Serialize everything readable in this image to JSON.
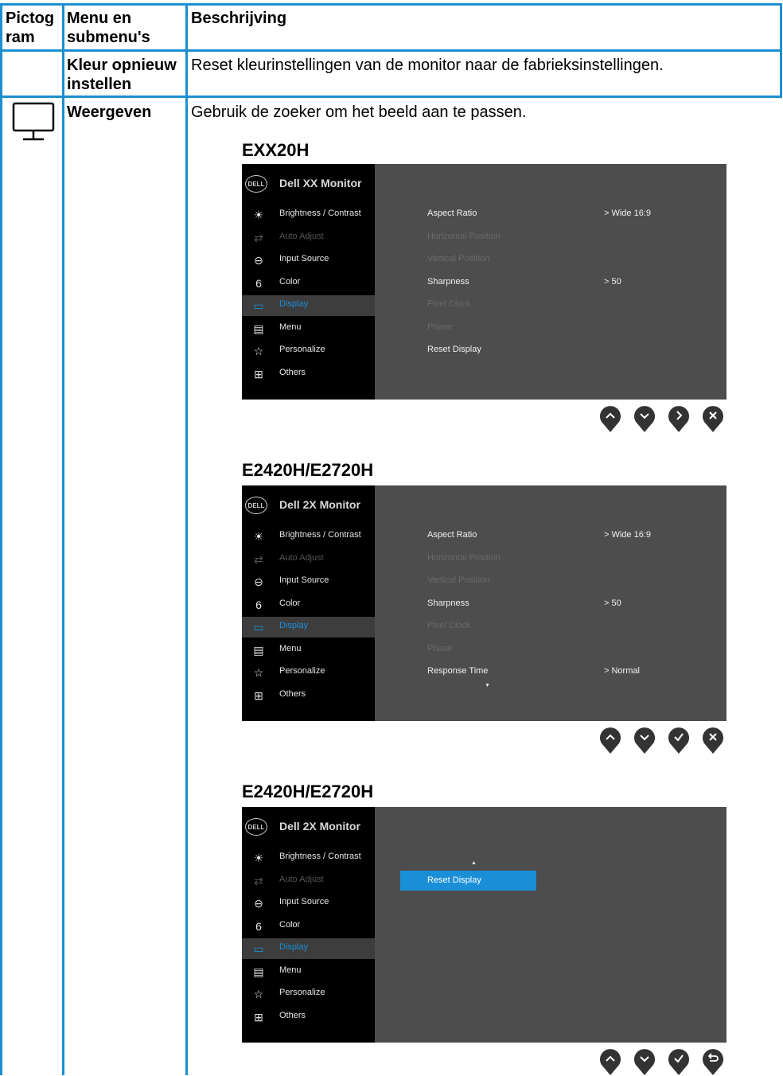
{
  "table": {
    "headers": {
      "icon": "Pictog ram",
      "menu": "Menu en submenu's",
      "desc": "Beschrijving"
    },
    "row1": {
      "menu_line1": "Kleur opnieuw",
      "menu_line2": "instellen",
      "description": "Reset kleurinstellingen van de monitor naar de fabrieksinstellingen."
    },
    "row2": {
      "icon": "monitor-icon",
      "menu": "Weergeven",
      "description": "Gebruik de zoeker om het beeld aan te passen."
    }
  },
  "osd_panels": [
    {
      "model": "EXX20H",
      "title": "Dell XX Monitor",
      "logo": "DELL",
      "menu": [
        {
          "label": "Brightness / Contrast",
          "icon": "brightness-icon",
          "state": "normal"
        },
        {
          "label": "Auto Adjust",
          "icon": "auto-adjust-icon",
          "state": "disabled"
        },
        {
          "label": "Input Source",
          "icon": "input-source-icon",
          "state": "normal"
        },
        {
          "label": "Color",
          "icon": "color-icon",
          "state": "normal"
        },
        {
          "label": "Display",
          "icon": "display-icon",
          "state": "active"
        },
        {
          "label": "Menu",
          "icon": "menu-icon",
          "state": "normal"
        },
        {
          "label": "Personalize",
          "icon": "star-icon",
          "state": "normal"
        },
        {
          "label": "Others",
          "icon": "others-icon",
          "state": "normal"
        }
      ],
      "options": [
        {
          "label": "Aspect Ratio",
          "value": "Wide 16:9",
          "state": "normal"
        },
        {
          "label": "Horizontal Position",
          "value": "",
          "state": "disabled"
        },
        {
          "label": "Vertical Position",
          "value": "",
          "state": "disabled"
        },
        {
          "label": "Sharpness",
          "value": "50",
          "state": "normal"
        },
        {
          "label": "Pixel Clock",
          "value": "",
          "state": "disabled"
        },
        {
          "label": "Phase",
          "value": "",
          "state": "disabled"
        },
        {
          "label": "Reset Display",
          "value": "",
          "state": "normal"
        }
      ],
      "value_prefix": ">",
      "buttons": [
        "up-icon",
        "down-icon",
        "right-icon",
        "close-icon"
      ]
    },
    {
      "model": "E2420H/E2720H",
      "title": "Dell 2X Monitor",
      "logo": "DELL",
      "menu": [
        {
          "label": "Brightness / Contrast",
          "icon": "brightness-icon",
          "state": "normal"
        },
        {
          "label": "Auto Adjust",
          "icon": "auto-adjust-icon",
          "state": "disabled"
        },
        {
          "label": "Input Source",
          "icon": "input-source-icon",
          "state": "normal"
        },
        {
          "label": "Color",
          "icon": "color-icon",
          "state": "normal"
        },
        {
          "label": "Display",
          "icon": "display-icon",
          "state": "active"
        },
        {
          "label": "Menu",
          "icon": "menu-icon",
          "state": "normal"
        },
        {
          "label": "Personalize",
          "icon": "star-icon",
          "state": "normal"
        },
        {
          "label": "Others",
          "icon": "others-icon",
          "state": "normal"
        }
      ],
      "options": [
        {
          "label": "Aspect Ratio",
          "value": "Wide 16:9",
          "state": "normal"
        },
        {
          "label": "Horizontal Position",
          "value": "",
          "state": "disabled"
        },
        {
          "label": "Vertical Position",
          "value": "",
          "state": "disabled"
        },
        {
          "label": "Sharpness",
          "value": "50",
          "state": "normal"
        },
        {
          "label": "Pixel Clock",
          "value": "",
          "state": "disabled"
        },
        {
          "label": "Phase",
          "value": "",
          "state": "disabled"
        },
        {
          "label": "Response Time",
          "value": "Normal",
          "state": "normal"
        }
      ],
      "value_prefix": ">",
      "buttons": [
        "up-icon",
        "down-icon",
        "check-icon",
        "close-icon"
      ]
    },
    {
      "model": "E2420H/E2720H",
      "title": "Dell 2X Monitor",
      "logo": "DELL",
      "menu": [
        {
          "label": "Brightness / Contrast",
          "icon": "brightness-icon",
          "state": "normal"
        },
        {
          "label": "Auto Adjust",
          "icon": "auto-adjust-icon",
          "state": "disabled"
        },
        {
          "label": "Input Source",
          "icon": "input-source-icon",
          "state": "normal"
        },
        {
          "label": "Color",
          "icon": "color-icon",
          "state": "normal"
        },
        {
          "label": "Display",
          "icon": "display-icon",
          "state": "active"
        },
        {
          "label": "Menu",
          "icon": "menu-icon",
          "state": "normal"
        },
        {
          "label": "Personalize",
          "icon": "star-icon",
          "state": "normal"
        },
        {
          "label": "Others",
          "icon": "others-icon",
          "state": "normal"
        }
      ],
      "options": [
        {
          "label": "Reset Display",
          "value": "",
          "state": "selected"
        }
      ],
      "value_prefix": ">",
      "buttons": [
        "up-icon",
        "down-icon",
        "check-icon",
        "back-icon"
      ]
    }
  ],
  "colors": {
    "border": "#1c8fd0",
    "highlight": "#1a8fd8",
    "osd_panel": "#4d4d4d",
    "osd_menu": "#000000"
  }
}
